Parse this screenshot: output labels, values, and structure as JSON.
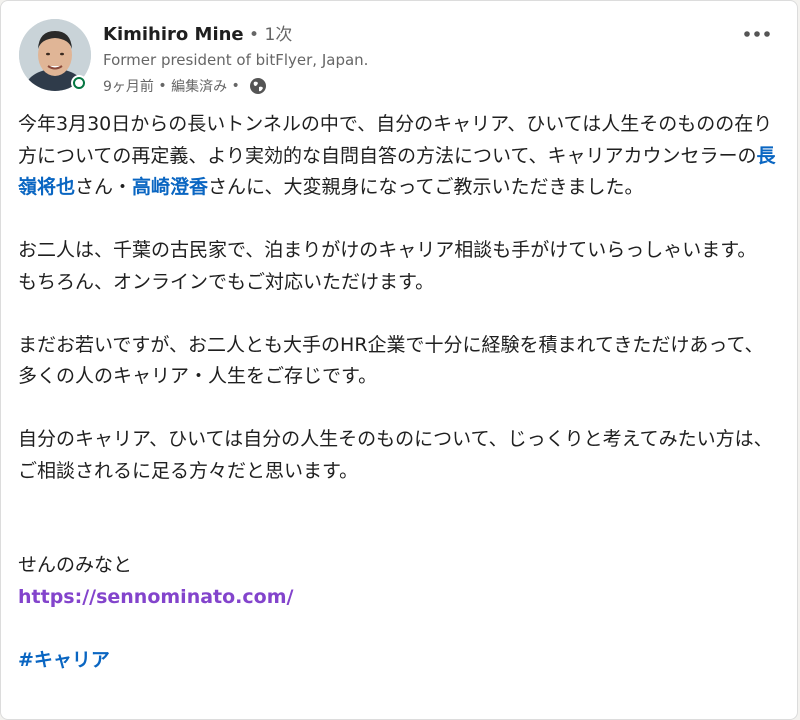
{
  "author": {
    "name": "Kimihiro Mine",
    "separator": " • ",
    "degree": "1次",
    "headline": "Former president of bitFlyer, Japan.",
    "time": "9ヶ月前",
    "edited": "編集済み",
    "visibility_icon": "globe-icon"
  },
  "menu": {
    "icon": "more-options-icon",
    "label": "•••"
  },
  "post": {
    "p1_a": "今年3月30日からの長いトンネルの中で、自分のキャリア、ひいては人生そのものの在り方についての再定義、より実効的な自問自答の方法について、キャリアカウンセラーの",
    "mention1": "長嶺将也",
    "p1_b": "さん・",
    "mention2": "高崎澄香",
    "p1_c": "さんに、大変親身になってご教示いただきました。",
    "p2_a": "お二人は、千葉の古民家で、泊まりがけのキャリア相談も手がけていらっしゃいます。",
    "p2_b": "もちろん、オンラインでもご対応いただけます。",
    "p3": "まだお若いですが、お二人とも大手のHR企業で十分に経験を積まれてきただけあって、多くの人のキャリア・人生をご存じです。",
    "p4": "自分のキャリア、ひいては自分の人生そのものについて、じっくりと考えてみたい方は、ご相談されるに足る方々だと思います。",
    "sign": "せんのみなと",
    "link": "https://sennominato.com/",
    "hashtag": "#キャリア"
  },
  "colors": {
    "mention": "#0a66c2",
    "link": "#8344cc",
    "online": "#057642"
  }
}
